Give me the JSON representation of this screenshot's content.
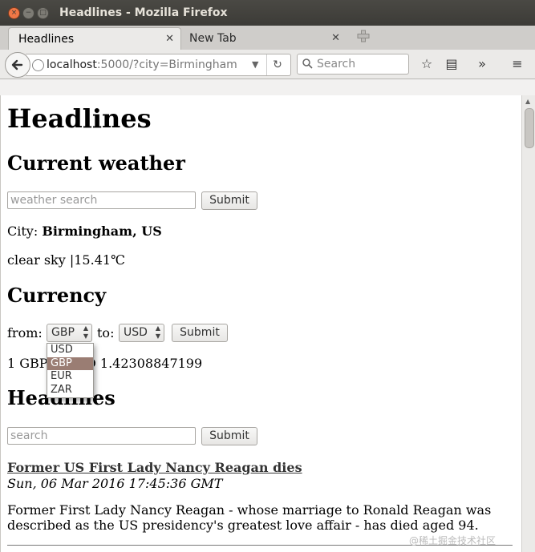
{
  "window": {
    "title": "Headlines - Mozilla Firefox"
  },
  "tabs": [
    {
      "label": "Headlines"
    },
    {
      "label": "New Tab"
    }
  ],
  "nav": {
    "url_host": "localhost",
    "url_rest": ":5000/?city=Birmingham",
    "search_placeholder": "Search"
  },
  "page": {
    "title": "Headlines",
    "weather": {
      "heading": "Current weather",
      "search_placeholder": "weather search",
      "submit_label": "Submit",
      "city_label": "City:",
      "city_value": "Birmingham, US",
      "description": "clear sky |15.41℃"
    },
    "currency": {
      "heading": "Currency",
      "from_label": "from:",
      "to_label": "to:",
      "from_value": "GBP",
      "to_value": "USD",
      "submit_label": "Submit",
      "result_prefix": "1 GBP",
      "result_suffix": "D 1.42308847199",
      "options": [
        "USD",
        "GBP",
        "EUR",
        "ZAR"
      ]
    },
    "headlines": {
      "heading": "Headlines",
      "search_placeholder": "search",
      "submit_label": "Submit",
      "article_title": "Former US First Lady Nancy Reagan dies",
      "article_date": "Sun, 06 Mar 2016 17:45:36 GMT",
      "article_body": "Former First Lady Nancy Reagan - whose marriage to Ronald Reagan was described as the US presidency's greatest love affair - has died aged 94."
    }
  },
  "watermark": "@稀土掘金技术社区"
}
